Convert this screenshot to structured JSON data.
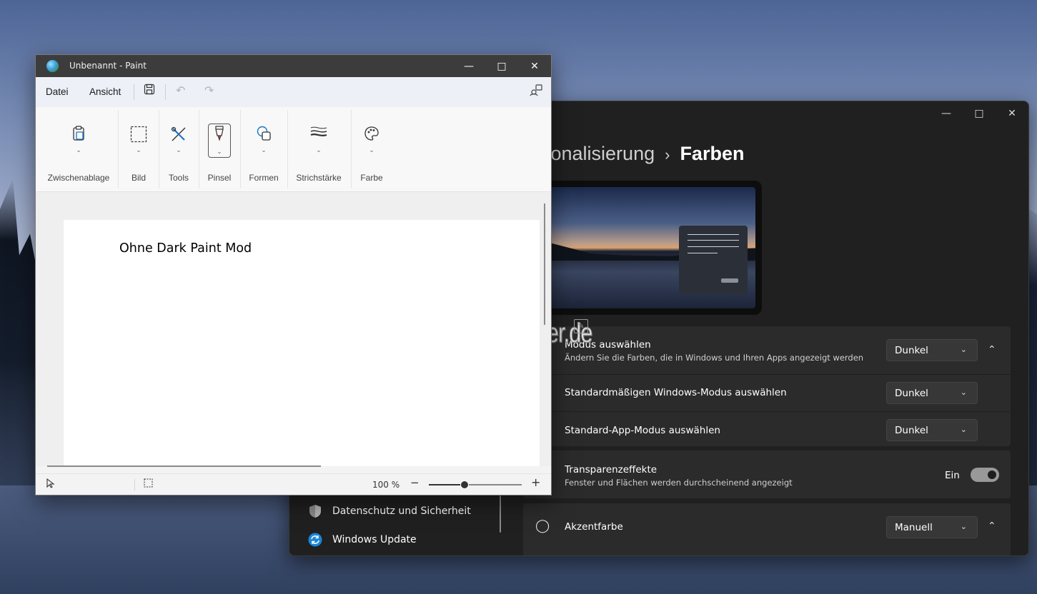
{
  "paint": {
    "window_title": "Unbenannt - Paint",
    "menu": {
      "file": "Datei",
      "view": "Ansicht"
    },
    "ribbon": [
      {
        "label": "Zwischenablage",
        "icon": "clipboard-icon"
      },
      {
        "label": "Bild",
        "icon": "selection-icon"
      },
      {
        "label": "Tools",
        "icon": "tools-icon"
      },
      {
        "label": "Pinsel",
        "icon": "brush-icon"
      },
      {
        "label": "Formen",
        "icon": "shapes-icon"
      },
      {
        "label": "Strichstärke",
        "icon": "stroke-size-icon"
      },
      {
        "label": "Farbe",
        "icon": "palette-icon"
      }
    ],
    "canvas_text": "Ohne Dark Paint Mod",
    "status": {
      "zoom": "100 %"
    }
  },
  "settings": {
    "breadcrumb_parent": "sonalisierung",
    "breadcrumb_sep": "›",
    "page_title": "Farben",
    "mode": {
      "title": "Modus auswählen",
      "desc": "Ändern Sie die Farben, die in Windows und Ihren Apps angezeigt werden",
      "value": "Dunkel"
    },
    "windows_mode": {
      "title": "Standardmäßigen Windows-Modus auswählen",
      "value": "Dunkel"
    },
    "app_mode": {
      "title": "Standard-App-Modus auswählen",
      "value": "Dunkel"
    },
    "transparency": {
      "title": "Transparenzeffekte",
      "desc": "Fenster und Flächen werden durchscheinend angezeigt",
      "state": "Ein"
    },
    "accent": {
      "title": "Akzentfarbe",
      "value": "Manuell"
    },
    "nav": [
      {
        "label": "Datenschutz und Sicherheit",
        "icon": "shield-icon"
      },
      {
        "label": "Windows Update",
        "icon": "update-icon"
      }
    ]
  },
  "watermark": "Deskmodder.de"
}
